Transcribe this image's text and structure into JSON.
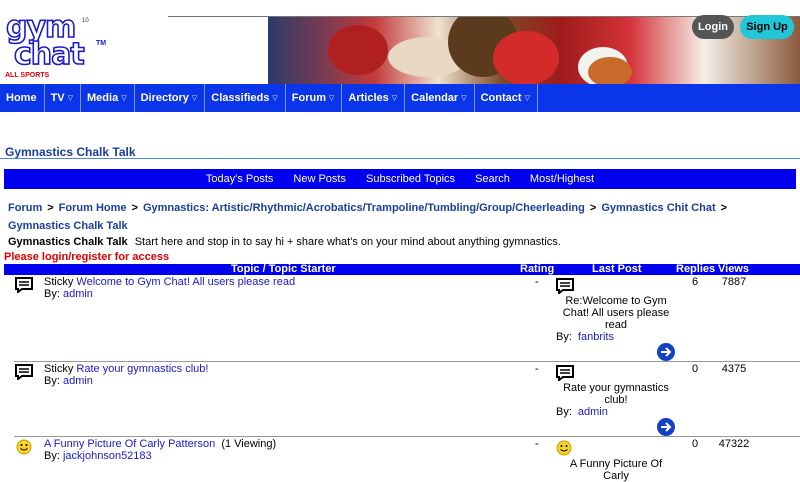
{
  "logo": {
    "line1": "gym",
    "line2": "chat",
    "tm": "TM",
    "version": "10",
    "tagline": "ALL SPORTS"
  },
  "auth": {
    "login": "Login",
    "signup": "Sign Up"
  },
  "nav": [
    {
      "label": "Home",
      "dropdown": false
    },
    {
      "label": "TV",
      "dropdown": true
    },
    {
      "label": "Media",
      "dropdown": true
    },
    {
      "label": "Directory",
      "dropdown": true
    },
    {
      "label": "Classifieds",
      "dropdown": true
    },
    {
      "label": "Forum",
      "dropdown": true
    },
    {
      "label": "Articles",
      "dropdown": true
    },
    {
      "label": "Calendar",
      "dropdown": true
    },
    {
      "label": "Contact",
      "dropdown": true
    }
  ],
  "page_title": "Gymnastics Chalk Talk",
  "subbar": [
    "Today's Posts",
    "New Posts",
    "Subscribed Topics",
    "Search",
    "Most/Highest"
  ],
  "breadcrumb": [
    "Forum",
    "Forum Home",
    "Gymnastics: Artistic/Rhythmic/Acrobatics/Trampoline/Tumbling/Group/Cheerleading",
    "Gymnastics Chit Chat",
    "Gymnastics Chalk Talk"
  ],
  "breadcrumb_sep": ">",
  "forum_desc": {
    "name": "Gymnastics Chalk Talk",
    "text": "Start here and stop in to say hi + share what's on your mind about anything gymnastics."
  },
  "login_notice": "Please login/register for access",
  "table_headers": {
    "topic": "Topic / Topic Starter",
    "rating": "Rating",
    "last_post": "Last Post",
    "replies": "Replies",
    "views": "Views"
  },
  "topics": [
    {
      "prefix": "Sticky",
      "title": "Welcome to Gym Chat! All users please read",
      "viewing": "",
      "by_label": "By:",
      "starter": "admin",
      "rating": "-",
      "last_post_title": "Re:Welcome to Gym Chat! All users please read",
      "last_post_by": "fanbrits",
      "replies": "6",
      "views": "7887",
      "icon": "comment-icon"
    },
    {
      "prefix": "Sticky",
      "title": "Rate your gymnastics club!",
      "viewing": "",
      "by_label": "By:",
      "starter": "admin",
      "rating": "-",
      "last_post_title": "Rate your gymnastics club!",
      "last_post_by": "admin",
      "replies": "0",
      "views": "4375",
      "icon": "comment-icon"
    },
    {
      "prefix": "",
      "title": "A Funny Picture Of Carly Patterson",
      "viewing": "(1 Viewing)",
      "by_label": "By:",
      "starter": "jackjohnson52183",
      "rating": "-",
      "last_post_title": "A Funny Picture Of Carly",
      "last_post_by": "",
      "replies": "0",
      "views": "47322",
      "icon": "smiley-icon"
    }
  ],
  "colors": {
    "nav_bg": "#0a35e8",
    "subbar_bg": "#0000f0",
    "link": "#1a1ac8",
    "title": "#1a3d9e",
    "notice": "#dd0000",
    "signup": "#21c6d8"
  }
}
